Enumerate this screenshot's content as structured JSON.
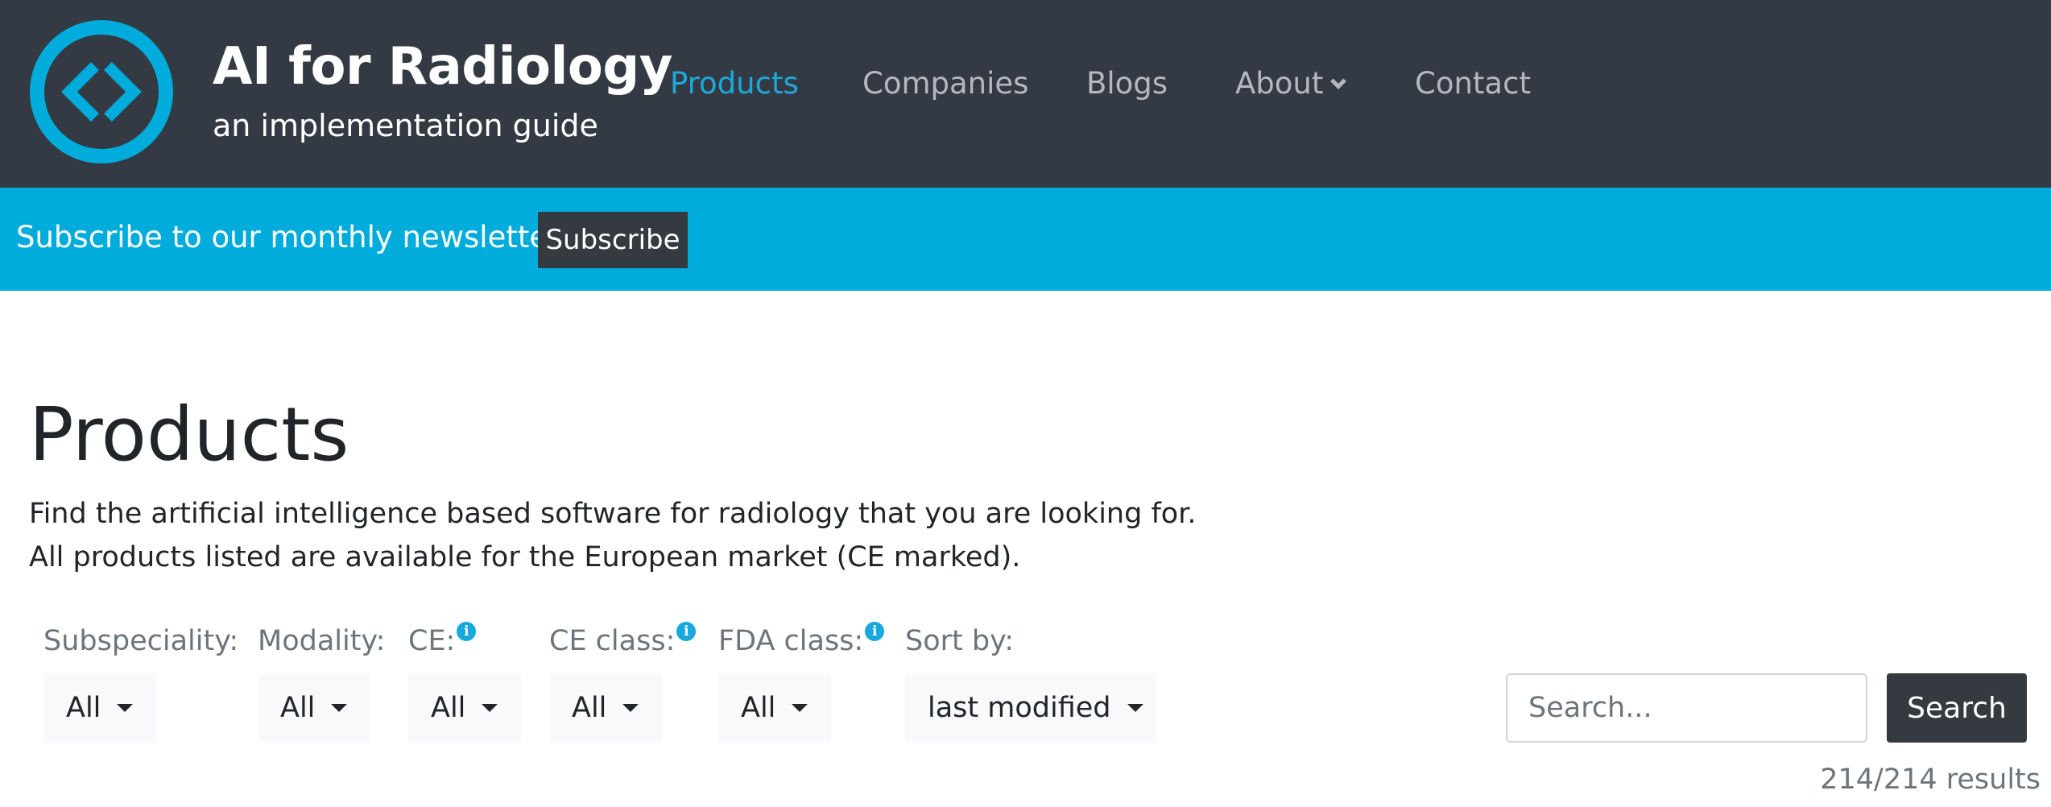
{
  "brand": {
    "title": "AI for Radiology",
    "subtitle": "an implementation guide",
    "logo_icon": "code-brackets-circle-icon",
    "accent": "#00acdb"
  },
  "nav": {
    "products": "Products",
    "companies": "Companies",
    "blogs": "Blogs",
    "about": "About",
    "contact": "Contact"
  },
  "newsletter": {
    "text": "Subscribe to our monthly newsletter",
    "button": "Subscribe"
  },
  "main": {
    "title": "Products",
    "desc_line1": "Find the artificial intelligence based software for radiology that you are looking for.",
    "desc_line2": "All products listed are available for the European market (CE marked)."
  },
  "filters": {
    "subspeciality": {
      "label": "Subspeciality:",
      "value": "All"
    },
    "modality": {
      "label": "Modality:",
      "value": "All"
    },
    "ce": {
      "label": "CE:",
      "value": "All"
    },
    "ce_class": {
      "label": "CE class:",
      "value": "All"
    },
    "fda_class": {
      "label": "FDA class:",
      "value": "All"
    },
    "sort_by": {
      "label": "Sort by:",
      "value": "last modified"
    }
  },
  "search": {
    "placeholder": "Search...",
    "button": "Search"
  },
  "results": "214/214 results",
  "colors": {
    "header_bg": "#343a43",
    "newsletter_bg": "#00acdb",
    "nav_active": "#1ca9d9",
    "button_dark": "#343a40"
  }
}
